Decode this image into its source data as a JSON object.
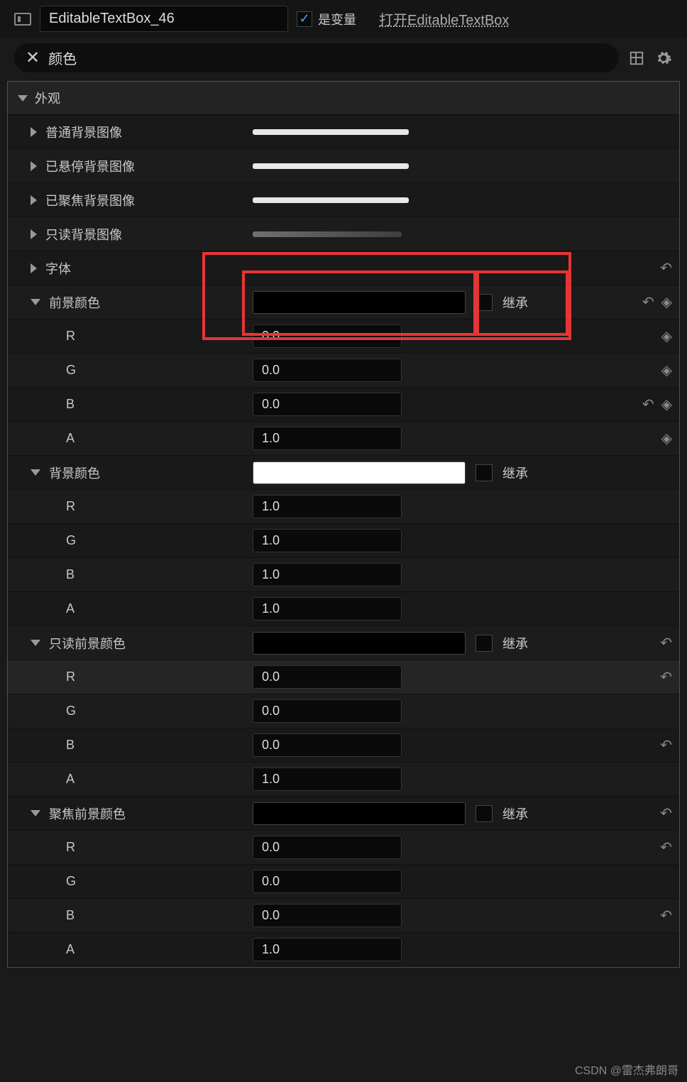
{
  "header": {
    "name": "EditableTextBox_46",
    "is_var_label": "是变量",
    "open_link": "打开EditableTextBox"
  },
  "search": {
    "value": "颜色"
  },
  "category": {
    "title": "外观"
  },
  "rows": {
    "normal_bg": "普通背景图像",
    "hover_bg": "已悬停背景图像",
    "focus_bg": "已聚焦背景图像",
    "readonly_bg": "只读背景图像",
    "font": "字体",
    "fg_color": "前景颜色",
    "bg_color": "背景颜色",
    "ro_fg_color": "只读前景颜色",
    "focus_fg_color": "聚焦前景颜色",
    "inherit": "继承",
    "r": "R",
    "g": "G",
    "b": "B",
    "a": "A"
  },
  "vals": {
    "fg": {
      "r": "0.0",
      "g": "0.0",
      "b": "0.0",
      "a": "1.0"
    },
    "bg": {
      "r": "1.0",
      "g": "1.0",
      "b": "1.0",
      "a": "1.0"
    },
    "ro": {
      "r": "0.0",
      "g": "0.0",
      "b": "0.0",
      "a": "1.0"
    },
    "fc": {
      "r": "0.0",
      "g": "0.0",
      "b": "0.0",
      "a": "1.0"
    }
  },
  "watermark": "CSDN @雷杰弗朗哥"
}
